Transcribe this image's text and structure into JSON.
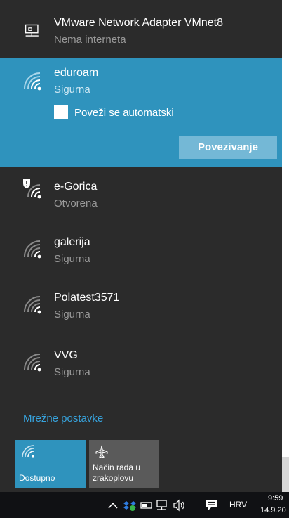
{
  "networks": {
    "vmware": {
      "name": "VMware Network Adapter VMnet8",
      "status": "Nema interneta",
      "icon": "ethernet-icon"
    },
    "selected": {
      "name": "eduroam",
      "status": "Sigurna",
      "auto_connect_label": "Poveži se automatski",
      "connect_label": "Povezivanje",
      "icon": "wifi-secure-icon"
    },
    "list": [
      {
        "name": "e-Gorica",
        "status": "Otvorena",
        "icon": "wifi-open-warning-icon"
      },
      {
        "name": "galerija",
        "status": "Sigurna",
        "icon": "wifi-secure-icon"
      },
      {
        "name": "Polatest3571",
        "status": "Sigurna",
        "icon": "wifi-secure-icon"
      },
      {
        "name": "VVG",
        "status": "Sigurna",
        "icon": "wifi-secure-icon"
      }
    ]
  },
  "settings_link": "Mrežne postavke",
  "quick_actions": {
    "wifi": {
      "label": "Dostupno",
      "icon": "wifi-icon"
    },
    "airplane": {
      "label_line1": "Način rada u",
      "label_line2": "zrakoplovu",
      "icon": "airplane-icon"
    }
  },
  "taskbar": {
    "language": "HRV",
    "time": "9:59",
    "date": "14.9.20"
  },
  "colors": {
    "accent": "#2f93bd",
    "link": "#37a3dd",
    "flyout_bg": "#2b2b2b"
  }
}
